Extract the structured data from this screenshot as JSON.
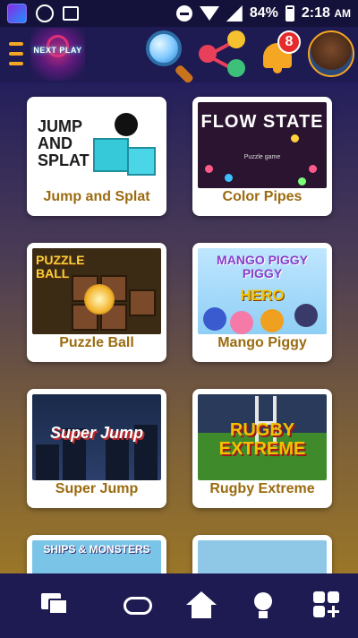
{
  "status_bar": {
    "battery": "84%",
    "time": "2:18",
    "ampm": "AM"
  },
  "header": {
    "logo_text": "NEXT PLAY",
    "notification_count": "8"
  },
  "games": [
    {
      "title": "Jump and Splat",
      "thumb_text": "JUMP AND SPLAT"
    },
    {
      "title": "Color Pipes",
      "thumb_text": "FLOW STATE",
      "thumb_sub": "Puzzle game"
    },
    {
      "title": "Puzzle Ball",
      "thumb_text": "PUZZLE BALL"
    },
    {
      "title": "Mango Piggy",
      "thumb_text": "MANGO PIGGY PIGGY",
      "thumb_sub": "HERO"
    },
    {
      "title": "Super Jump",
      "thumb_text": "Super Jump"
    },
    {
      "title": "Rugby Extreme",
      "thumb_text": "RUGBY EXTREME"
    },
    {
      "title": "",
      "thumb_text": "SHIPS & MONSTERS"
    },
    {
      "title": "",
      "thumb_text": ""
    }
  ],
  "bottom_nav": {
    "icons": [
      "chat-icon",
      "gamepad-icon",
      "home-icon",
      "lightbulb-icon",
      "apps-add-icon"
    ]
  },
  "colors": {
    "header_bg": "#1e1a52",
    "accent": "#f5a623",
    "card_title": "#9b6b10",
    "badge": "#e52b2b"
  }
}
